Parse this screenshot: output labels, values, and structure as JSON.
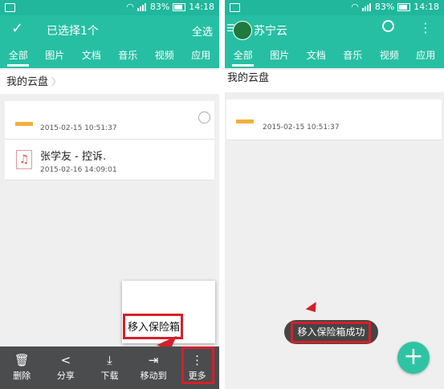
{
  "status": {
    "battery": "83%",
    "time": "14:18",
    "network": "2G"
  },
  "left": {
    "title": "已选择1个",
    "select_all": "全选",
    "tabs": [
      "全部",
      "图片",
      "文档",
      "音乐",
      "视频",
      "应用"
    ],
    "breadcrumb": "我的云盘",
    "items": [
      {
        "name": "",
        "date": "2015-02-15 10:51:37",
        "type": "folder"
      },
      {
        "name": "张学友 - 控诉.",
        "date": "2015-02-16 14:09:01",
        "type": "music"
      }
    ],
    "menu_partial": "",
    "menu_item": "移入保险箱",
    "bottom": [
      "删除",
      "分享",
      "下载",
      "移动到",
      "更多"
    ]
  },
  "right": {
    "title": "苏宁云",
    "tabs": [
      "全部",
      "图片",
      "文档",
      "音乐",
      "视频",
      "应用"
    ],
    "breadcrumb": "我的云盘",
    "items": [
      {
        "name": "",
        "date": "2015-02-15 10:51:37",
        "type": "folder"
      }
    ],
    "toast": "移入保险箱成功",
    "fab": "+"
  },
  "colors": {
    "primary": "#27bfa3",
    "highlight": "#d4202a",
    "folder": "#f2b03c",
    "toolbar": "#4b4c4e"
  }
}
